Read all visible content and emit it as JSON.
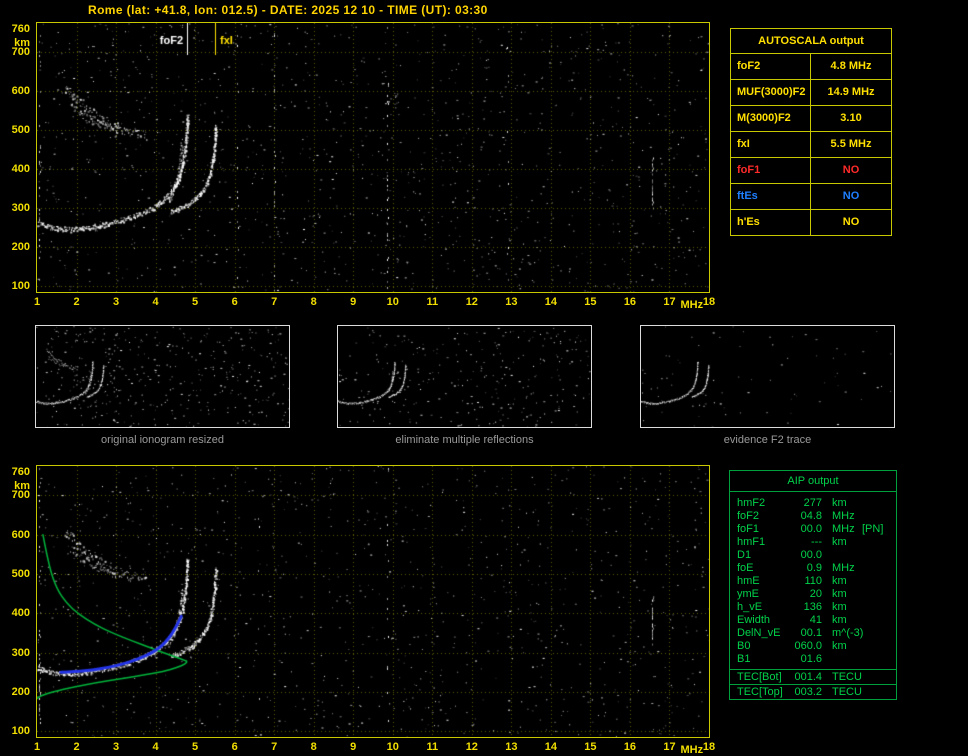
{
  "header": {
    "title": "Rome (lat: +41.8, lon: 012.5) - DATE: 2025 12 10 - TIME (UT): 03:30"
  },
  "autoscala_table": {
    "title": "AUTOSCALA output",
    "rows": [
      {
        "label": "foF2",
        "value": "4.8 MHz",
        "color": "#ffe000"
      },
      {
        "label": "MUF(3000)F2",
        "value": "14.9 MHz",
        "color": "#ffe000"
      },
      {
        "label": "M(3000)F2",
        "value": "3.10",
        "color": "#ffe000"
      },
      {
        "label": "fxI",
        "value": "5.5 MHz",
        "color": "#ffe000"
      },
      {
        "label": "foF1",
        "value": "NO",
        "color": "#ff2a2a"
      },
      {
        "label": "ftEs",
        "value": "NO",
        "color": "#1f7fff"
      },
      {
        "label": "h'Es",
        "value": "NO",
        "color": "#ffe000"
      }
    ]
  },
  "thumbnails": [
    {
      "caption": "original ionogram resized",
      "traces": [
        "F2-ordinary",
        "F2-extraordinary",
        "spread-echo",
        "second-hop-upper",
        "second-hop-lower"
      ],
      "speckles": 420,
      "seed": 3
    },
    {
      "caption": "eliminate multiple reflections",
      "traces": [
        "F2-ordinary",
        "F2-extraordinary",
        "spread-echo"
      ],
      "speckles": 300,
      "seed": 4
    },
    {
      "caption": "evidence F2 trace",
      "traces": [
        "F2-ordinary",
        "F2-extraordinary"
      ],
      "speckles": 80,
      "seed": 5
    }
  ],
  "aip_table": {
    "title": "AIP output",
    "rows": [
      {
        "label": "hmF2",
        "value": "277",
        "unit": "km",
        "note": ""
      },
      {
        "label": "foF2",
        "value": "04.8",
        "unit": "MHz",
        "note": ""
      },
      {
        "label": "foF1",
        "value": "00.0",
        "unit": "MHz",
        "note": "[PN]"
      },
      {
        "label": "hmF1",
        "value": "---",
        "unit": "km",
        "note": ""
      },
      {
        "label": "D1",
        "value": "00.0",
        "unit": "",
        "note": ""
      },
      {
        "label": "foE",
        "value": "0.9",
        "unit": "MHz",
        "note": ""
      },
      {
        "label": "hmE",
        "value": "110",
        "unit": "km",
        "note": ""
      },
      {
        "label": "ymE",
        "value": "20",
        "unit": "km",
        "note": ""
      },
      {
        "label": "h_vE",
        "value": "136",
        "unit": "km",
        "note": ""
      },
      {
        "label": "Ewidth",
        "value": "41",
        "unit": "km",
        "note": ""
      },
      {
        "label": "DelN_vE",
        "value": "00.1",
        "unit": "m^(-3)",
        "note": ""
      },
      {
        "label": "B0",
        "value": "060.0",
        "unit": "km",
        "note": ""
      },
      {
        "label": "B1",
        "value": "01.6",
        "unit": "",
        "note": ""
      }
    ],
    "tec_rows": [
      {
        "label": "TEC[Bot]",
        "value": "001.4",
        "unit": "TECU"
      },
      {
        "label": "TEC[Top]",
        "value": "003.2",
        "unit": "TECU"
      }
    ]
  },
  "chart_data": [
    {
      "id": "top_ionogram",
      "type": "scatter",
      "title": "ionogram with AUTOSCALA scaled characteristics",
      "xlabel": "MHz",
      "ylabel": "km",
      "xlim": [
        1,
        18
      ],
      "ylim": [
        85,
        775
      ],
      "x_ticks": [
        1,
        2,
        3,
        4,
        5,
        6,
        7,
        8,
        9,
        10,
        11,
        12,
        13,
        14,
        15,
        16,
        17,
        18
      ],
      "y_ticks": [
        760,
        700,
        600,
        500,
        400,
        300,
        200,
        100
      ],
      "grid": true,
      "grid_color": "#5c5c00",
      "annotations": [
        {
          "text": "foF2",
          "f": 4.8,
          "color": "#ffffff",
          "side": "left"
        },
        {
          "text": "fxI",
          "f": 5.5,
          "color": "#ffe000",
          "side": "right"
        }
      ],
      "traces": [
        {
          "name": "F2-ordinary",
          "color": "#ffffff",
          "jitter": 2.4,
          "density": 2,
          "alpha": 1,
          "points": [
            [
              1.02,
              262
            ],
            [
              1.25,
              254
            ],
            [
              1.55,
              248
            ],
            [
              1.85,
              246
            ],
            [
              2.15,
              249
            ],
            [
              2.45,
              254
            ],
            [
              2.75,
              260
            ],
            [
              3.05,
              268
            ],
            [
              3.35,
              277
            ],
            [
              3.65,
              288
            ],
            [
              3.9,
              300
            ],
            [
              4.1,
              314
            ],
            [
              4.3,
              332
            ],
            [
              4.45,
              352
            ],
            [
              4.58,
              378
            ],
            [
              4.68,
              410
            ],
            [
              4.74,
              452
            ],
            [
              4.78,
              500
            ],
            [
              4.8,
              540
            ]
          ]
        },
        {
          "name": "F2-extraordinary",
          "color": "#ffffff",
          "jitter": 2.2,
          "density": 2,
          "alpha": 1,
          "points": [
            [
              4.4,
              292
            ],
            [
              4.65,
              302
            ],
            [
              4.9,
              316
            ],
            [
              5.1,
              334
            ],
            [
              5.25,
              356
            ],
            [
              5.36,
              384
            ],
            [
              5.44,
              418
            ],
            [
              5.49,
              460
            ],
            [
              5.52,
              515
            ]
          ]
        },
        {
          "name": "spread-echo",
          "color": "#ffffff",
          "jitter": 3,
          "density": 1,
          "alpha": 0.8,
          "points": [
            [
              4.32,
              320
            ],
            [
              4.45,
              348
            ],
            [
              4.55,
              382
            ],
            [
              4.62,
              425
            ],
            [
              4.66,
              470
            ]
          ]
        },
        {
          "name": "second-hop-upper",
          "color": "#ffffff",
          "jitter": 5,
          "density": 1,
          "alpha": 0.8,
          "points": [
            [
              1.7,
              610
            ],
            [
              2.0,
              580
            ],
            [
              2.3,
              553
            ],
            [
              2.6,
              531
            ],
            [
              2.9,
              514
            ],
            [
              3.2,
              501
            ],
            [
              3.5,
              492
            ],
            [
              3.8,
              487
            ]
          ]
        },
        {
          "name": "second-hop-lower",
          "color": "#ffffff",
          "jitter": 4,
          "density": 1,
          "alpha": 0.7,
          "points": [
            [
              1.85,
              562
            ],
            [
              2.15,
              540
            ],
            [
              2.45,
              522
            ],
            [
              2.75,
              508
            ],
            [
              3.05,
              499
            ]
          ]
        }
      ],
      "noise": {
        "speckles": 1200,
        "streaks": [
          {
            "f": 1.05,
            "h1": 90,
            "h2": 770,
            "density": 0.22
          },
          {
            "f": 6.05,
            "h1": 90,
            "h2": 770,
            "density": 0.1
          },
          {
            "f": 7.0,
            "h1": 90,
            "h2": 770,
            "density": 0.16
          },
          {
            "f": 9.85,
            "h1": 90,
            "h2": 770,
            "density": 0.22
          },
          {
            "f": 12.9,
            "h1": 90,
            "h2": 770,
            "density": 0.07
          },
          {
            "f": 16.55,
            "h1": 300,
            "h2": 430,
            "density": 0.85
          }
        ]
      }
    },
    {
      "id": "bottom_ionogram",
      "type": "scatter",
      "title": "ionogram with AIP electron density profile",
      "xlabel": "MHz",
      "ylabel": "km",
      "xlim": [
        1,
        18
      ],
      "ylim": [
        85,
        775
      ],
      "x_ticks": [
        1,
        2,
        3,
        4,
        5,
        6,
        7,
        8,
        9,
        10,
        11,
        12,
        13,
        14,
        15,
        16,
        17,
        18
      ],
      "y_ticks": [
        760,
        700,
        600,
        500,
        400,
        300,
        200,
        100
      ],
      "grid": true,
      "grid_color": "#5c5c00",
      "annotations": [],
      "traces_ref": "top_ionogram",
      "profile": {
        "name": "electron-density-profile",
        "color": "#00b43c",
        "points": [
          [
            1.15,
            600
          ],
          [
            1.3,
            520
          ],
          [
            1.5,
            462
          ],
          [
            1.75,
            425
          ],
          [
            2.05,
            398
          ],
          [
            2.45,
            372
          ],
          [
            2.9,
            350
          ],
          [
            3.4,
            330
          ],
          [
            3.9,
            311
          ],
          [
            4.3,
            296
          ],
          [
            4.6,
            285
          ],
          [
            4.75,
            280
          ],
          [
            4.8,
            277
          ],
          [
            4.75,
            271
          ],
          [
            4.55,
            262
          ],
          [
            4.2,
            252
          ],
          [
            3.7,
            243
          ],
          [
            3.1,
            233
          ],
          [
            2.5,
            223
          ],
          [
            1.9,
            212
          ],
          [
            1.4,
            200
          ],
          [
            1.1,
            190
          ],
          [
            1.0,
            183
          ]
        ]
      },
      "fitted_trace": {
        "name": "restored-F2-trace",
        "color": "#2334e8",
        "points": [
          [
            1.6,
            250
          ],
          [
            2.0,
            251
          ],
          [
            2.4,
            256
          ],
          [
            2.8,
            262
          ],
          [
            3.15,
            270
          ],
          [
            3.5,
            281
          ],
          [
            3.8,
            294
          ],
          [
            4.05,
            308
          ],
          [
            4.25,
            326
          ],
          [
            4.42,
            348
          ],
          [
            4.55,
            372
          ],
          [
            4.65,
            392
          ]
        ]
      },
      "noise": {
        "speckles": 1050,
        "streaks": [
          {
            "f": 1.05,
            "h1": 90,
            "h2": 770,
            "density": 0.2
          },
          {
            "f": 6.6,
            "h1": 90,
            "h2": 770,
            "density": 0.09
          },
          {
            "f": 9.85,
            "h1": 90,
            "h2": 770,
            "density": 0.1
          },
          {
            "f": 16.55,
            "h1": 320,
            "h2": 440,
            "density": 0.8
          }
        ]
      }
    }
  ]
}
